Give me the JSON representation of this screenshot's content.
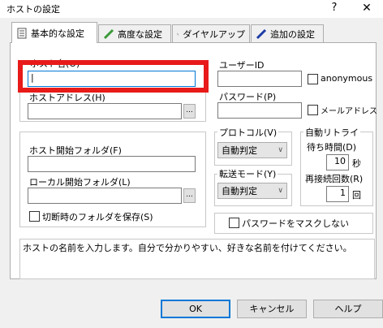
{
  "window": {
    "title": "ホストの設定",
    "help_glyph": "?",
    "close_glyph": "✕"
  },
  "tabs": [
    {
      "label": "基本的な設定",
      "icon": "document-icon",
      "active": true
    },
    {
      "label": "高度な設定",
      "icon": "pen-icon",
      "active": false
    },
    {
      "label": "ダイヤルアップ",
      "icon": "phone-icon",
      "active": false
    },
    {
      "label": "追加の設定",
      "icon": "blue-pen-icon",
      "active": false
    }
  ],
  "host": {
    "name_label": "ホスト名(O)",
    "name_value": "|",
    "address_label": "ホストアドレス(H)",
    "address_value": ""
  },
  "auth": {
    "user_label": "ユーザーID",
    "user_value": "",
    "anonymous_label": "anonymous",
    "password_label": "パスワード(P)",
    "password_value": "",
    "mail_label": "メールアドレス"
  },
  "folders": {
    "host_start_label": "ホスト開始フォルダ(F)",
    "host_start_value": "",
    "local_start_label": "ローカル開始フォルダ(L)",
    "local_start_value": "",
    "save_on_disconnect_label": "切断時のフォルダを保存(S)"
  },
  "protocol": {
    "label": "プロトコル(V)",
    "value": "自動判定"
  },
  "transfer": {
    "label": "転送モード(Y)",
    "value": "自動判定"
  },
  "retry": {
    "label": "自動リトライ",
    "wait_label": "待ち時間(D)",
    "wait_value": "10",
    "wait_unit": "秒",
    "reconnect_label": "再接続回数(R)",
    "reconnect_value": "1",
    "reconnect_unit": "回"
  },
  "mask_password_label": "パスワードをマスクしない",
  "browse_label": "...",
  "help_text": "ホストの名前を入力します。自分で分かりやすい、好きな名前を付けてください。",
  "buttons": {
    "ok": "OK",
    "cancel": "キャンセル",
    "help": "ヘルプ"
  },
  "colors": {
    "highlight": "#e81a1a",
    "focus": "#0078d7"
  }
}
